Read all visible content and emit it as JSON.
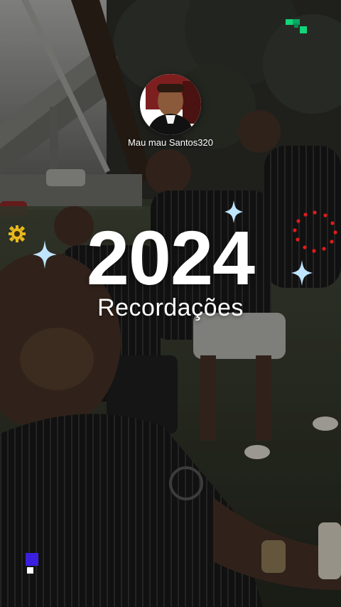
{
  "profile": {
    "username": "Mau mau Santos320"
  },
  "recap": {
    "year": "2024",
    "title": "Recordações"
  },
  "theme": {
    "accent_green": "#11d67a",
    "accent_blue": "#3b1fe0",
    "sparkle": "#bfe4ff",
    "gear_yellow": "#e8b81c",
    "dots_red": "#e01b1b"
  },
  "icons": {
    "sparkle": "sparkle-icon",
    "gear": "gear-icon",
    "pixel_glyph": "pixel-glyph-icon",
    "dot_ring": "dot-ring-icon"
  }
}
